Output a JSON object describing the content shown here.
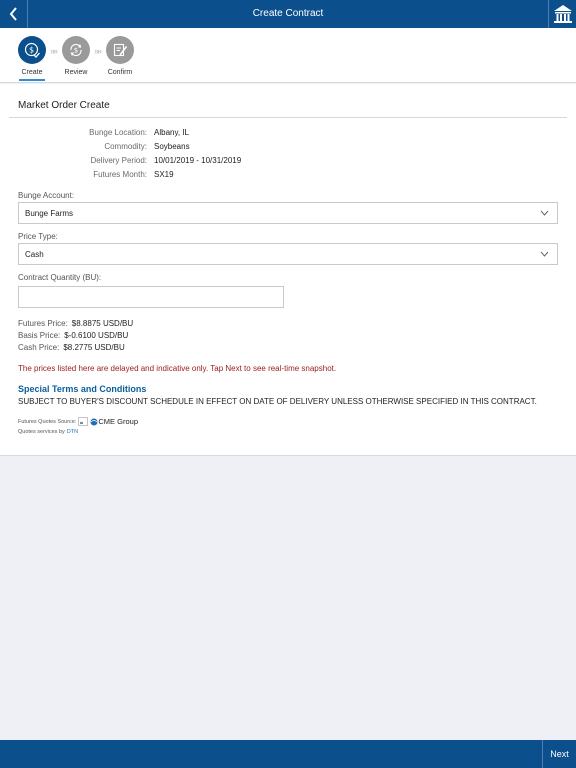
{
  "header": {
    "title": "Create Contract",
    "back_icon": "chevron-left-icon",
    "home_icon": "bank-building-icon"
  },
  "stepper": {
    "steps": [
      {
        "label": "Create",
        "icon": "dollar-check-icon",
        "state": "active"
      },
      {
        "label": "Review",
        "icon": "dollar-refresh-icon",
        "state": "inactive"
      },
      {
        "label": "Confirm",
        "icon": "document-edit-icon",
        "state": "inactive"
      }
    ],
    "separator": "»»"
  },
  "form": {
    "section_title": "Market Order Create",
    "info": [
      {
        "label": "Bunge Location:",
        "value": "Albany, IL"
      },
      {
        "label": "Commodity:",
        "value": "Soybeans"
      },
      {
        "label": "Delivery Period:",
        "value": "10/01/2019 - 10/31/2019"
      },
      {
        "label": "Futures Month:",
        "value": "SX19"
      }
    ],
    "bunge_account": {
      "label": "Bunge Account:",
      "value": "Bunge Farms"
    },
    "price_type": {
      "label": "Price Type:",
      "value": "Cash"
    },
    "contract_quantity": {
      "label": "Contract Quantity (BU):",
      "value": "",
      "placeholder": ""
    },
    "prices": [
      {
        "label": "Futures Price:",
        "value": "$8.8875 USD/BU"
      },
      {
        "label": "Basis Price:",
        "value": "$-0.6100 USD/BU"
      },
      {
        "label": "Cash Price:",
        "value": "$8.2775 USD/BU"
      }
    ],
    "disclaimer": "The prices listed here are delayed and indicative only. Tap Next to see real-time snapshot.",
    "terms_title": "Special Terms and Conditions",
    "terms_text": "SUBJECT TO BUYER'S DISCOUNT SCHEDULE IN EFFECT ON DATE OF DELIVERY UNLESS OTHERWISE SPECIFIED IN THIS CONTRACT.",
    "quotes_source_label": "Futures Quotes Source:",
    "quotes_source_name": "CME Group",
    "quotes_services_label": "Quotes services by",
    "quotes_services_name": "DTN"
  },
  "footer": {
    "next_label": "Next"
  },
  "colors": {
    "brand": "#0b4f8c",
    "accent": "#2f8fd8",
    "warning": "#9b1b1b",
    "link": "#0b5e9c"
  }
}
